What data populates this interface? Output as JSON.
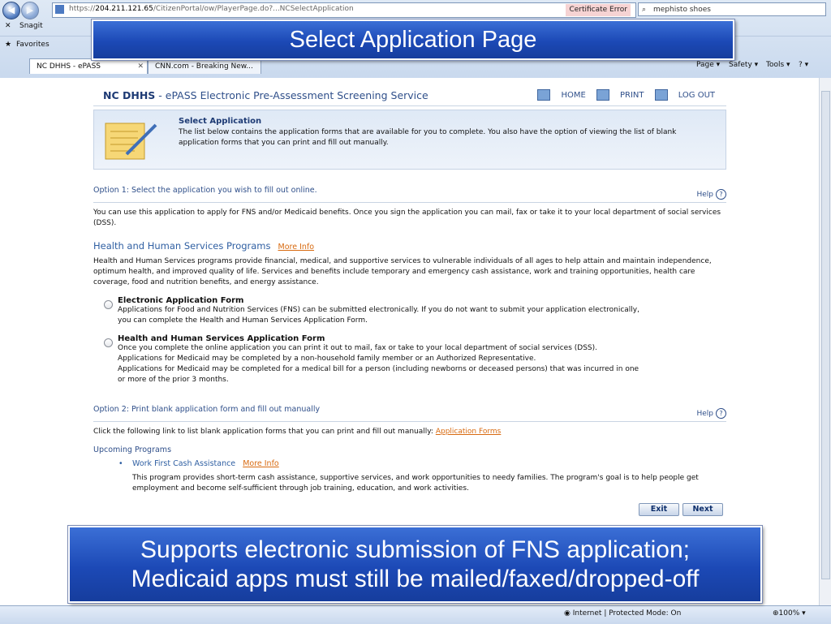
{
  "browser": {
    "url_prefix": "https://",
    "host": "204.211.121.65",
    "url_rest": "/CitizenPortal/ow/PlayerPage.do?...NCSelectApplication",
    "cert_error": "Certificate Error",
    "search_value": "mephisto shoes",
    "snagit": "Snagit",
    "favorites": "Favorites",
    "tabs": [
      {
        "label": "NC DHHS - ePASS",
        "active": true
      },
      {
        "label": "CNN.com - Breaking New...",
        "active": false
      }
    ],
    "commands": {
      "page": "Page ▾",
      "safety": "Safety ▾",
      "tools": "Tools ▾",
      "help": "? ▾"
    }
  },
  "site": {
    "brand_bold": "NC DHHS",
    "brand_rest": " - ePASS Electronic Pre-Assessment Screening Service",
    "home": "HOME",
    "print": "PRINT",
    "logout": "LOG OUT"
  },
  "intro": {
    "title": "Select Application",
    "text": "The list below contains the application forms that are available for you to complete. You also have the option of viewing the list of blank application forms that you can print and fill out manually."
  },
  "option1": {
    "heading": "Option 1: Select the application you wish to fill out online.",
    "help": "Help",
    "body": "You can use this application to apply for FNS and/or Medicaid benefits. Once you sign the application you can mail, fax or take it to your local department of social services (DSS)."
  },
  "hhs": {
    "title": "Health and Human Services Programs",
    "more_info": "More Info",
    "body": "Health and Human Services programs provide financial, medical, and supportive services to vulnerable individuals of all ages to help attain and maintain independence, optimum health, and improved quality of life. Services and benefits include temporary and emergency cash assistance, work and training opportunities, health care coverage, food and nutrition benefits, and energy assistance."
  },
  "forms": [
    {
      "label": "Electronic Application Form",
      "lines": [
        "Applications for Food and Nutrition Services (FNS) can be submitted electronically. If you do not want to submit your application electronically,",
        "you can complete the Health and Human Services Application Form."
      ]
    },
    {
      "label": "Health and Human Services Application Form",
      "lines": [
        "Once you complete the online application you can print it out to mail, fax or take to your local department of social services (DSS).",
        "Applications for Medicaid may be completed by a non-household family member or an Authorized Representative.",
        "Applications for Medicaid may be completed for a medical bill for a person (including newborns or deceased persons) that was incurred in one",
        "or more of the prior 3 months."
      ]
    }
  ],
  "option2": {
    "heading": "Option 2: Print blank application form and fill out manually",
    "help": "Help",
    "body": "Click the following link to list blank application forms that you can print and fill out manually: ",
    "link": "Application Forms"
  },
  "upcoming": {
    "heading": "Upcoming Programs",
    "item": "Work First Cash Assistance",
    "more_info": "More Info",
    "desc": "This program provides short-term cash assistance, supportive services, and work opportunities to needy families. The program's goal is to help people get employment and become self-sufficient through job training, education, and work activities."
  },
  "buttons": {
    "exit": "Exit",
    "next": "Next"
  },
  "status": {
    "zone": "Internet | Protected Mode: On",
    "zoom": "100%"
  },
  "slide": {
    "title": "Select Application Page",
    "caption_line1": "Supports electronic submission of FNS application;",
    "caption_line2": "Medicaid apps must still be mailed/faxed/dropped-off"
  },
  "colors": {
    "slide_blue": "#1c49b6",
    "link_orange": "#d86a10",
    "heading_blue": "#2f4f8a"
  }
}
